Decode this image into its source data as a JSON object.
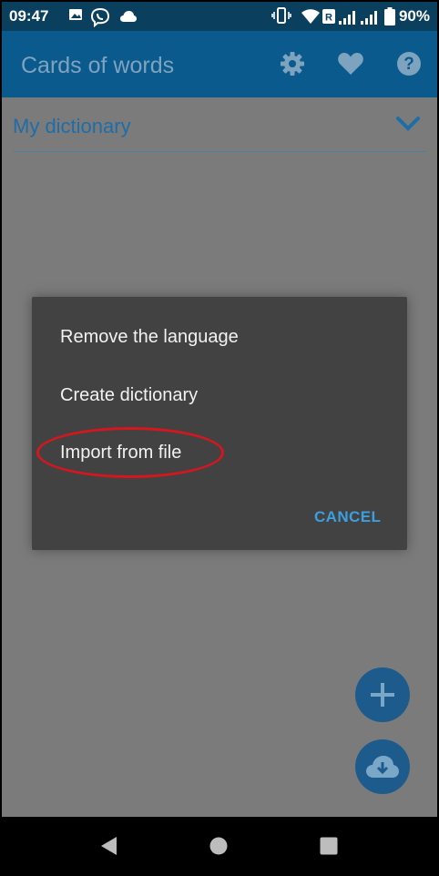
{
  "status_bar": {
    "time": "09:47",
    "battery_percent": "90%",
    "icons": [
      "image-icon",
      "viber-icon",
      "cloud-icon",
      "vibrate-icon",
      "wifi-icon",
      "sim-r-icon",
      "signal-icon",
      "signal-icon",
      "battery-icon"
    ]
  },
  "app_bar": {
    "title": "Cards of words",
    "actions": [
      "settings-icon",
      "heart-icon",
      "help-icon"
    ]
  },
  "dictionary_selector": {
    "label": "My dictionary"
  },
  "dialog": {
    "items": [
      "Remove the language",
      "Create dictionary",
      "Import from file"
    ],
    "cancel_label": "CANCEL"
  },
  "fabs": [
    "add-icon",
    "cloud-download-icon"
  ],
  "nav_bar": [
    "back-icon",
    "home-icon",
    "recents-icon"
  ],
  "colors": {
    "status_bar": "#0b3f5e",
    "app_bar": "#0b5a8e",
    "content_dim": "#7b7b7b",
    "dialog_bg": "#424242",
    "accent": "#3c9fe0",
    "highlight": "#d4161f"
  }
}
